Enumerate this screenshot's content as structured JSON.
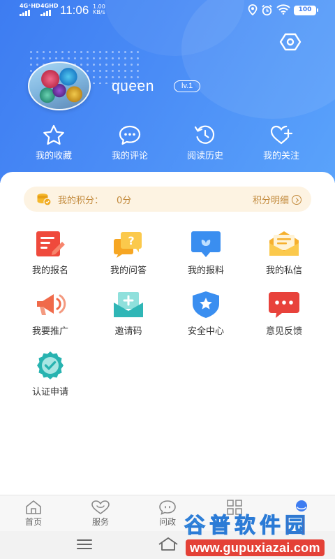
{
  "status_bar": {
    "sim1": "4G⁺HD",
    "sim2": "4GHD",
    "time": "11:06",
    "speed_value": "1.00",
    "speed_unit": "KB/s",
    "battery": "100"
  },
  "profile": {
    "username": "queen",
    "level": "lv.1"
  },
  "quick_actions": [
    {
      "label": "我的收藏",
      "icon": "star-icon"
    },
    {
      "label": "我的评论",
      "icon": "comment-icon"
    },
    {
      "label": "阅读历史",
      "icon": "history-icon"
    },
    {
      "label": "我的关注",
      "icon": "heart-plus-icon"
    }
  ],
  "points": {
    "label": "我的积分：",
    "value": "0分",
    "detail_link": "积分明细"
  },
  "menu_items": [
    {
      "label": "我的报名",
      "icon": "signup-icon",
      "color": "#ef4a3c"
    },
    {
      "label": "我的问答",
      "icon": "qa-icon",
      "color": "#f6a623"
    },
    {
      "label": "我的报料",
      "icon": "report-icon",
      "color": "#3a8ef0"
    },
    {
      "label": "我的私信",
      "icon": "mail-icon",
      "color": "#f6b02d"
    },
    {
      "label": "我要推广",
      "icon": "megaphone-icon",
      "color": "#f06a4a"
    },
    {
      "label": "邀请码",
      "icon": "invite-icon",
      "color": "#2fb6b6"
    },
    {
      "label": "安全中心",
      "icon": "shield-icon",
      "color": "#3a8ef0"
    },
    {
      "label": "意见反馈",
      "icon": "feedback-icon",
      "color": "#e8423b"
    },
    {
      "label": "认证申请",
      "icon": "verified-icon",
      "color": "#27b3b0"
    }
  ],
  "tabs": [
    {
      "label": "首页",
      "icon": "home-icon"
    },
    {
      "label": "服务",
      "icon": "heart-icon"
    },
    {
      "label": "问政",
      "icon": "chat-icon"
    }
  ],
  "watermark": {
    "chars": [
      "谷",
      "普",
      "软",
      "件",
      "园"
    ],
    "url": "www.gupuxiazai.com"
  },
  "colors": {
    "header_start": "#3d7cf1",
    "header_end": "#5aa3fb",
    "points_bg": "#fdf3e2",
    "points_text": "#c18839"
  }
}
